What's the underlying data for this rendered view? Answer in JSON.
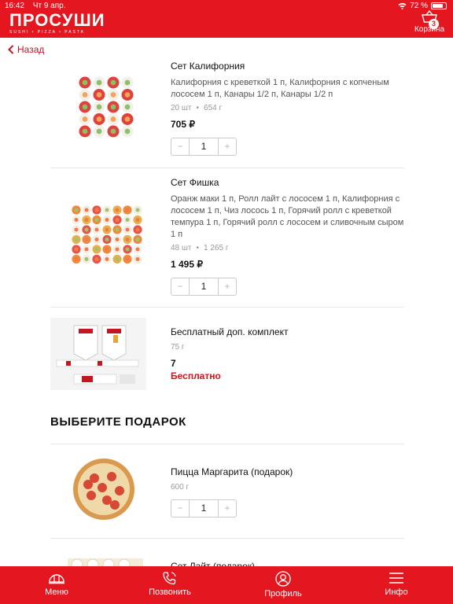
{
  "status_bar": {
    "time": "16:42",
    "date": "Чт 9 апр.",
    "battery": "72 %"
  },
  "header": {
    "logo": "ПРОСУШИ",
    "logo_tagline": "SUSHI • PIZZA • PASTA",
    "cart_label": "Корзина",
    "cart_count": "3"
  },
  "nav": {
    "back_label": "Назад"
  },
  "items": [
    {
      "name": "Сет Калифорния",
      "description": "Калифорния с креветкой 1 п, Калифорния с копченым лососем 1 п, Канары 1/2 п, Канары 1/2 п",
      "count": "20 шт",
      "weight": "654 г",
      "price": "705 ₽",
      "quantity": "1"
    },
    {
      "name": "Сет Фишка",
      "description": "Оранж маки 1 п, Ролл лайт с лососем 1 п, Калифорния с лососем 1 п, Чиз лосось 1 п, Горячий ролл с креветкой темпура 1 п, Горячий ролл с лососем и сливочным сыром 1 п",
      "count": "48 шт",
      "weight": "1 265 г",
      "price": "1 495 ₽",
      "quantity": "1"
    },
    {
      "name": "Бесплатный доп. комплект",
      "weight": "75 г",
      "quantity": "7",
      "price_label": "Бесплатно"
    }
  ],
  "gift_section": {
    "title": "ВЫБЕРИТЕ ПОДАРОК",
    "items": [
      {
        "name": "Пицца Маргарита (подарок)",
        "weight": "600 г",
        "quantity": "1"
      },
      {
        "name": "Сет Лайт (подарок)"
      }
    ]
  },
  "stepper": {
    "minus": "−",
    "plus": "+"
  },
  "tabbar": [
    {
      "label": "Меню",
      "icon": "menu-dome-icon"
    },
    {
      "label": "Позвонить",
      "icon": "phone-icon"
    },
    {
      "label": "Профиль",
      "icon": "profile-icon"
    },
    {
      "label": "Инфо",
      "icon": "hamburger-icon"
    }
  ],
  "colors": {
    "brand_red": "#e4161f",
    "accent_red": "#d0141c"
  }
}
